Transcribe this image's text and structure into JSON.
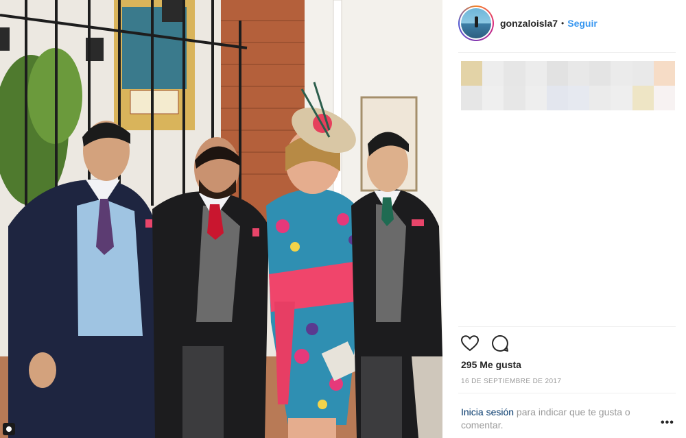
{
  "post": {
    "username": "gonzaloisla7",
    "separator": "•",
    "follow_label": "Seguir",
    "likes": "295 Me gusta",
    "date": "16 de septiembre de 2017",
    "login_link": "Inicia sesión",
    "login_rest": " para indicar que te gusta o comentar.",
    "more_glyph": "•••"
  },
  "icons": {
    "like": "heart-icon",
    "comment": "comment-icon",
    "more": "more-options-icon"
  },
  "colors": {
    "link_blue": "#3897f0",
    "text_dark": "#262626",
    "text_gray": "#999999",
    "login_blue": "#003569"
  }
}
